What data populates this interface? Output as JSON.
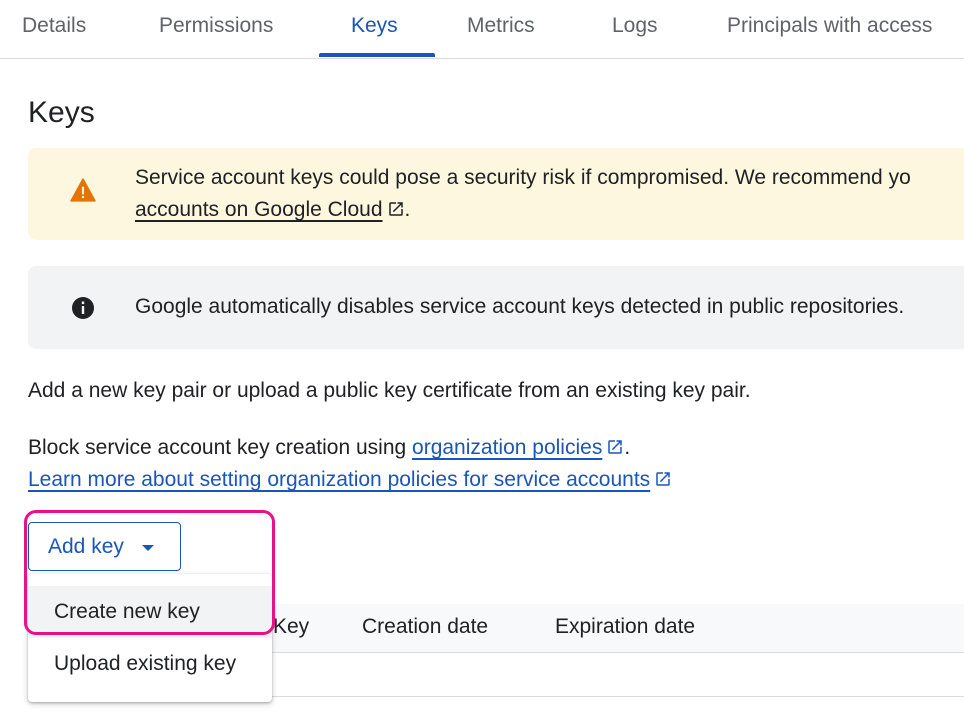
{
  "tabs": [
    {
      "label": "Details"
    },
    {
      "label": "Permissions"
    },
    {
      "label": "Keys",
      "active": true
    },
    {
      "label": "Metrics"
    },
    {
      "label": "Logs"
    },
    {
      "label": "Principals with access"
    }
  ],
  "page": {
    "title": "Keys"
  },
  "warning_banner": {
    "icon": "warning-icon",
    "line1": "Service account keys could pose a security risk if compromised. We recommend yo",
    "link": "accounts on Google Cloud",
    "tail": "."
  },
  "info_banner": {
    "icon": "info-icon",
    "text": "Google automatically disables service account keys detected in public repositories."
  },
  "intro": {
    "text": "Add a new key pair or upload a public key certificate from an existing key pair.",
    "block_prefix": "Block service account key creation using ",
    "block_link": "organization policies",
    "block_suffix": ".",
    "learn_more_link": "Learn more about setting organization policies for service accounts"
  },
  "add_key": {
    "label": "Add key",
    "icon": "arrow-drop-down-icon"
  },
  "add_key_menu": {
    "items": [
      {
        "label": "Create new key",
        "highlighted": true
      },
      {
        "label": "Upload existing key"
      }
    ]
  },
  "table": {
    "columns": [
      "Key",
      "Creation date",
      "Expiration date"
    ]
  },
  "colors": {
    "accent": "#1a56b8",
    "warning_bg": "#fef7e0",
    "warning_icon": "#e37400",
    "info_bg": "#f1f3f4",
    "highlight": "#e8118a"
  }
}
